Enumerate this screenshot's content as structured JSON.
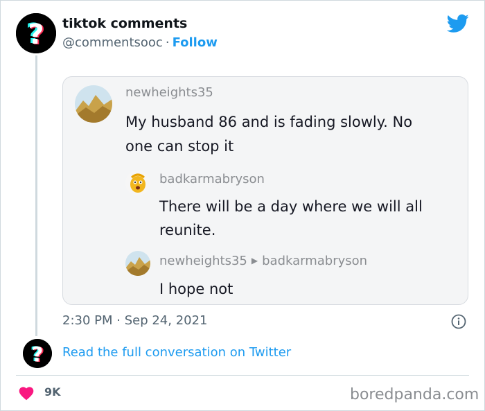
{
  "author": {
    "name": "tiktok comments",
    "handle": "@commentsooc",
    "separator": "·",
    "follow_label": "Follow"
  },
  "icons": {
    "brand": "twitter-bird-icon",
    "avatar": "tiktok-question-mark-icon",
    "info": "info-icon",
    "like": "heart-icon"
  },
  "colors": {
    "accent": "#1d9bf0",
    "like": "#f91880",
    "muted": "#536471"
  },
  "screenshot": {
    "comments": [
      {
        "user": "newheights35",
        "text_line1": "My husband 86 and is fading slowly. No",
        "text_line2": "one can stop it"
      },
      {
        "user": "badkarmabryson",
        "text_line1": "There will be a day where we will all",
        "text_line2": "reunite."
      },
      {
        "user": "newheights35",
        "reply_to": "badkarmabryson",
        "reply_arrow": "▶",
        "text_line1": "I hope not"
      }
    ]
  },
  "timestamp": "2:30 PM · Sep 24, 2021",
  "read_full_label": "Read the full conversation on Twitter",
  "likes_count": "9K",
  "watermark": "boredpanda.com"
}
